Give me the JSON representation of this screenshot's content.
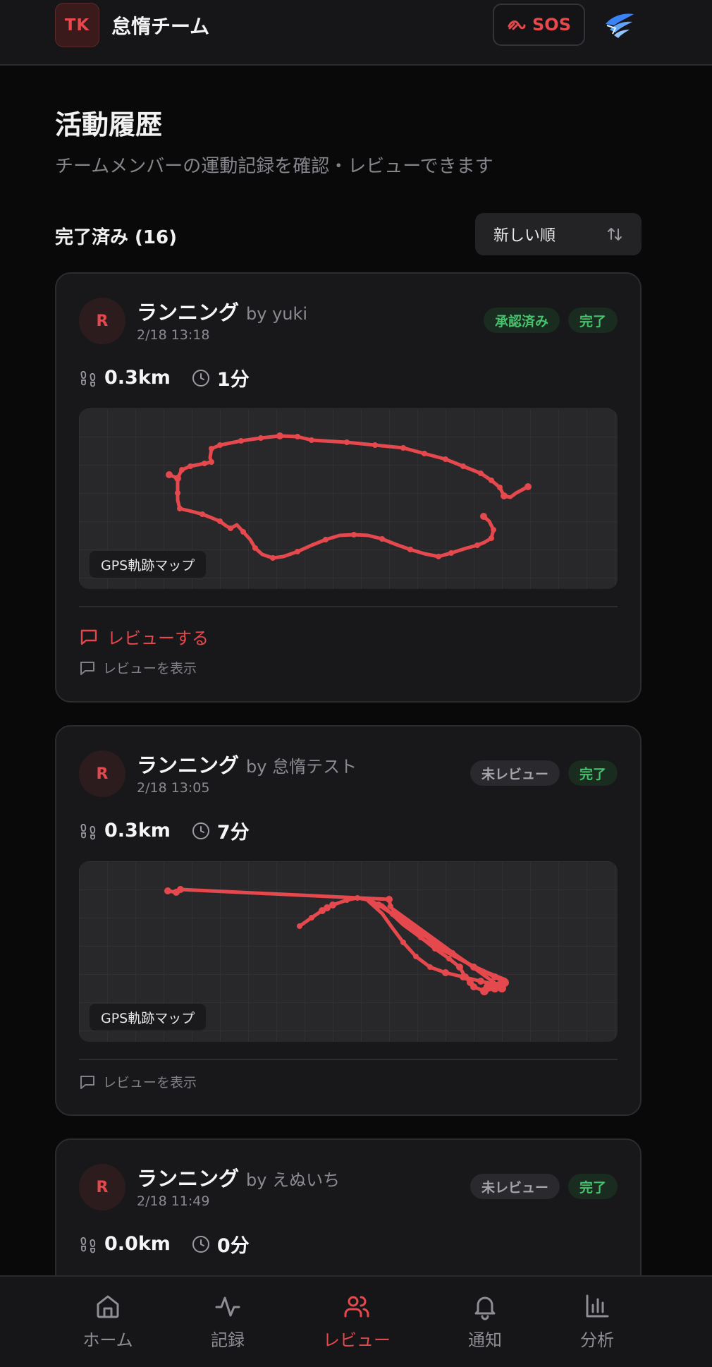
{
  "header": {
    "team_badge": "TK",
    "team_name": "怠惰チーム",
    "sos_label": "SOS"
  },
  "page": {
    "title": "活動履歴",
    "subtitle": "チームメンバーの運動記録を確認・レビューできます",
    "count_label": "完了済み (16)",
    "sort_value": "新しい順"
  },
  "cards": [
    {
      "avatar": "R",
      "activity": "ランニング",
      "by": "by yuki",
      "time": "2/18 13:18",
      "badges": [
        "承認済み",
        "完了"
      ],
      "distance": "0.3km",
      "duration": "1分",
      "map_label": "GPS軌跡マップ",
      "review_action": "レビューする",
      "review_show": "レビューを表示"
    },
    {
      "avatar": "R",
      "activity": "ランニング",
      "by": "by 怠惰テスト",
      "time": "2/18 13:05",
      "badges": [
        "未レビュー",
        "完了"
      ],
      "distance": "0.3km",
      "duration": "7分",
      "map_label": "GPS軌跡マップ",
      "review_show": "レビューを表示"
    },
    {
      "avatar": "R",
      "activity": "ランニング",
      "by": "by えぬいち",
      "time": "2/18 11:49",
      "badges": [
        "未レビュー",
        "完了"
      ],
      "distance": "0.0km",
      "duration": "0分"
    }
  ],
  "nav": [
    {
      "label": "ホーム",
      "icon": "home-icon"
    },
    {
      "label": "記録",
      "icon": "activity-icon"
    },
    {
      "label": "レビュー",
      "icon": "users-icon",
      "active": true
    },
    {
      "label": "通知",
      "icon": "bell-icon"
    },
    {
      "label": "分析",
      "icon": "chart-icon"
    }
  ],
  "colors": {
    "accent": "#e5484d",
    "success": "#46c16c",
    "background": "#09090a",
    "card": "#18181b"
  }
}
